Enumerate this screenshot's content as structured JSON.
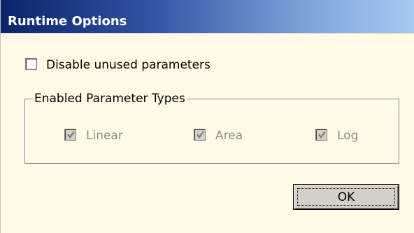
{
  "window": {
    "title": "Runtime Options"
  },
  "disable_unused": {
    "label": "Disable unused parameters",
    "checked": false
  },
  "parameter_types": {
    "legend": "Enabled Parameter Types",
    "items": [
      {
        "label": "Linear",
        "checked": true,
        "enabled": false
      },
      {
        "label": "Area",
        "checked": true,
        "enabled": false
      },
      {
        "label": "Log",
        "checked": true,
        "enabled": false
      }
    ]
  },
  "buttons": {
    "ok_label": "OK"
  },
  "colors": {
    "background": "#fffbe6",
    "title_gradient_start": "#0a246a",
    "title_gradient_end": "#a6caf0",
    "disabled_text": "#8c8c8c"
  }
}
